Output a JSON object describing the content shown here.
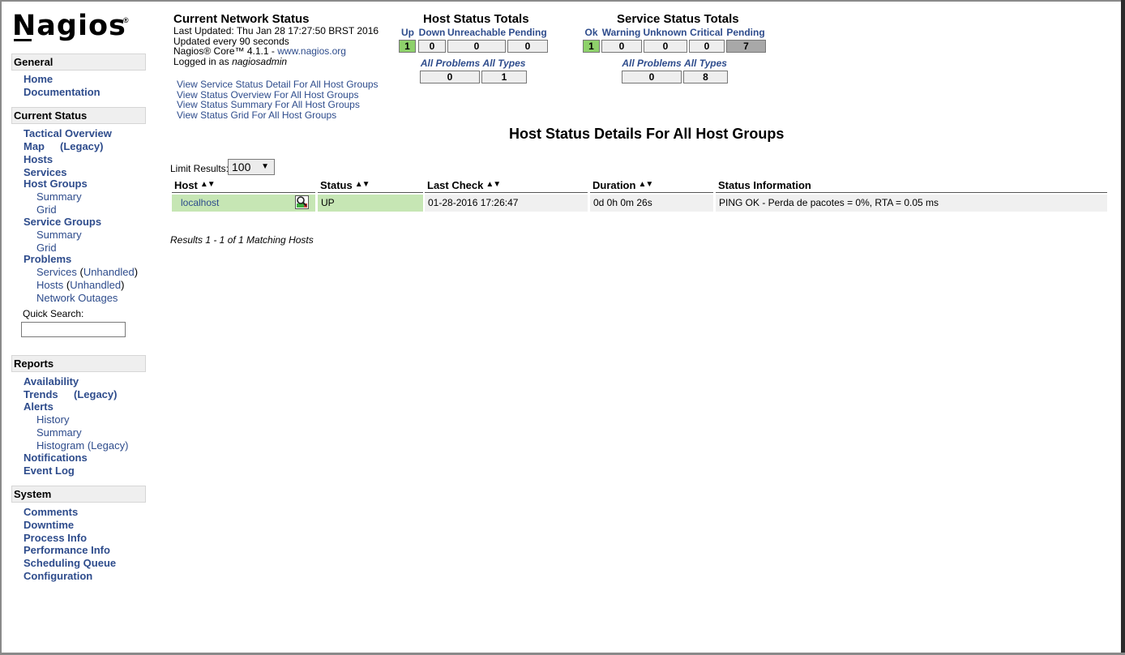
{
  "logo": {
    "text": "Nagios",
    "reg": "®"
  },
  "sidebar": {
    "general": {
      "title": "General",
      "items": [
        "Home",
        "Documentation"
      ]
    },
    "current_status": {
      "title": "Current Status",
      "tactical": "Tactical Overview",
      "map": "Map",
      "map_legacy": "(Legacy)",
      "hosts": "Hosts",
      "services": "Services",
      "host_groups": "Host Groups",
      "hg_summary": "Summary",
      "hg_grid": "Grid",
      "service_groups": "Service Groups",
      "sg_summary": "Summary",
      "sg_grid": "Grid",
      "problems": "Problems",
      "prob_services": "Services",
      "prob_hosts": "Hosts",
      "unhandled": "Unhandled",
      "network_outages": "Network Outages",
      "quick_search_label": "Quick Search:"
    },
    "reports": {
      "title": "Reports",
      "availability": "Availability",
      "trends": "Trends",
      "trends_legacy": "(Legacy)",
      "alerts": "Alerts",
      "history": "History",
      "summary": "Summary",
      "histogram": "Histogram (Legacy)",
      "notifications": "Notifications",
      "event_log": "Event Log"
    },
    "system": {
      "title": "System",
      "items": [
        "Comments",
        "Downtime",
        "Process Info",
        "Performance Info",
        "Scheduling Queue",
        "Configuration"
      ]
    }
  },
  "status_info": {
    "title": "Current Network Status",
    "last_updated": "Last Updated: Thu Jan 28 17:27:50 BRST 2016",
    "update_interval": "Updated every 90 seconds",
    "core_prefix": "Nagios® Core™ 4.1.1 - ",
    "core_link": "www.nagios.org",
    "logged_prefix": "Logged in as ",
    "user": "nagiosadmin",
    "links": [
      "View Service Status Detail For All Host Groups",
      "View Status Overview For All Host Groups",
      "View Status Summary For All Host Groups",
      "View Status Grid For All Host Groups"
    ]
  },
  "host_totals": {
    "title": "Host Status Totals",
    "headers": [
      "Up",
      "Down",
      "Unreachable",
      "Pending"
    ],
    "values": [
      "1",
      "0",
      "0",
      "0"
    ],
    "all_problems_label": "All Problems",
    "all_types_label": "All Types",
    "all_problems": "0",
    "all_types": "1"
  },
  "service_totals": {
    "title": "Service Status Totals",
    "headers": [
      "Ok",
      "Warning",
      "Unknown",
      "Critical",
      "Pending"
    ],
    "values": [
      "1",
      "0",
      "0",
      "0",
      "7"
    ],
    "all_problems_label": "All Problems",
    "all_types_label": "All Types",
    "all_problems": "0",
    "all_types": "8"
  },
  "page_heading": "Host Status Details For All Host Groups",
  "limit": {
    "label": "Limit Results:",
    "value": "100"
  },
  "table": {
    "headers": [
      "Host",
      "Status",
      "Last Check",
      "Duration",
      "Status Information"
    ],
    "rows": [
      {
        "host": "localhost",
        "status": "UP",
        "last_check": "01-28-2016 17:26:47",
        "duration": "0d 0h 0m 26s",
        "info": "PING OK - Perda de pacotes = 0%, RTA = 0.05 ms"
      }
    ]
  },
  "results_text": "Results 1 - 1 of 1 Matching Hosts",
  "colors": {
    "link": "#2e4c8c",
    "up_green": "#8ed16b",
    "row_green": "#c6e6b4",
    "pending_gray": "#a8a8a8"
  }
}
